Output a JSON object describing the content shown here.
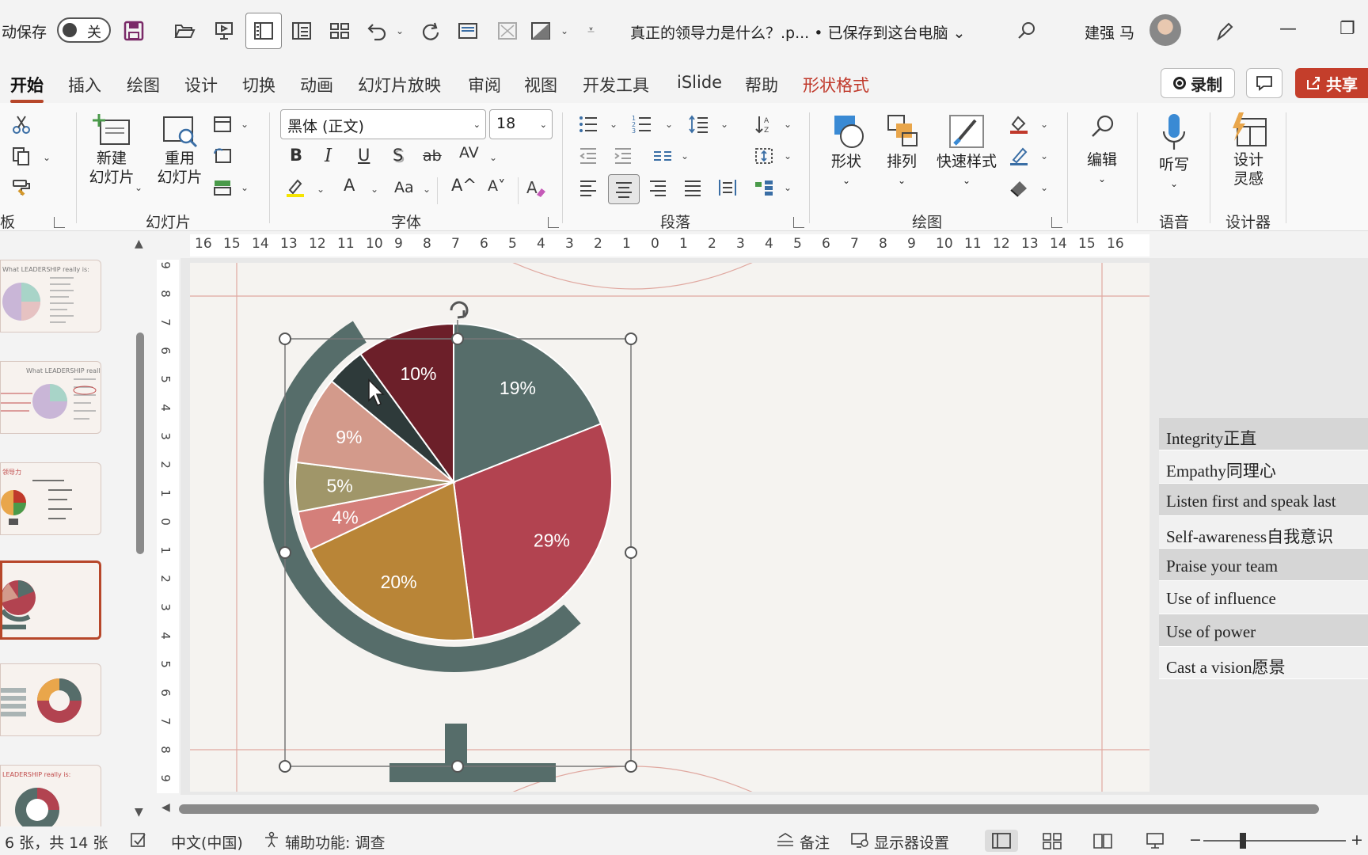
{
  "titlebar": {
    "autosave_label": "动保存",
    "autosave_state": "关",
    "doc_title": "真正的领导力是什么？.p... • 已保存到这台电脑 ⌄",
    "user_name": "建强 马",
    "minimize": "—",
    "restore": "❐"
  },
  "tabs": {
    "items": [
      "开始",
      "插入",
      "绘图",
      "设计",
      "切换",
      "动画",
      "幻灯片放映",
      "审阅",
      "视图",
      "开发工具",
      "iSlide",
      "帮助",
      "形状格式"
    ],
    "record_label": "录制",
    "share_label": "共享"
  },
  "ribbon": {
    "clipboard": {
      "label": "板"
    },
    "slides": {
      "new_slide": [
        "新建",
        "幻灯片"
      ],
      "reuse_slide": [
        "重用",
        "幻灯片"
      ],
      "label": "幻灯片"
    },
    "font": {
      "font_name": "黑体 (正文)",
      "font_size": "18",
      "label": "字体",
      "bold": "B",
      "italic": "I",
      "underline": "U",
      "shadow": "S",
      "strike": "ab",
      "spacing": "AV",
      "color_a": "A",
      "case": "Aa",
      "grow": "A^",
      "shrink": "A˅"
    },
    "paragraph": {
      "label": "段落"
    },
    "drawing": {
      "shapes": "形状",
      "arrange": "排列",
      "quick_styles": "快速样式",
      "label": "绘图"
    },
    "editing": {
      "edit": "编辑"
    },
    "voice": {
      "dictate": "听写",
      "label": "语音"
    },
    "designer": {
      "design_ideas": [
        "设计",
        "灵感"
      ],
      "label": "设计器"
    }
  },
  "chart_data": {
    "type": "pie",
    "slice_labels": [
      "19%",
      "29%",
      "20%",
      "4%",
      "5%",
      "9%",
      "",
      "10%"
    ],
    "values": [
      19,
      29,
      20,
      4,
      5,
      9,
      4,
      10
    ],
    "colors": [
      "#566d6a",
      "#b24350",
      "#b98537",
      "#d47f7a",
      "#a09669",
      "#d39a8b",
      "#2e3a3a",
      "#6c1f29"
    ],
    "legend": [
      "Integrity正直",
      "Empathy同理心",
      "Listen first and speak last",
      "Self-awareness自我意识",
      "Praise your team",
      "Use of influence",
      "Use of power",
      "Cast a vision愿景"
    ]
  },
  "ruler": {
    "horizontal": [
      "16",
      "15",
      "14",
      "13",
      "12",
      "11",
      "10",
      "9",
      "8",
      "7",
      "6",
      "5",
      "4",
      "3",
      "2",
      "1",
      "0",
      "1",
      "2",
      "3",
      "4",
      "5",
      "6",
      "7",
      "8",
      "9",
      "10",
      "11",
      "12",
      "13",
      "14",
      "15",
      "16"
    ],
    "vertical": [
      "9",
      "8",
      "7",
      "6",
      "5",
      "4",
      "3",
      "2",
      "1",
      "0",
      "1",
      "2",
      "3",
      "4",
      "5",
      "6",
      "7",
      "8",
      "9"
    ]
  },
  "statusbar": {
    "slide_count": "6 张，共 14 张",
    "language": "中文(中国)",
    "accessibility": "辅助功能: 调查",
    "notes": "备注",
    "display_settings": "显示器设置",
    "zoom_minus": "−",
    "zoom_plus": "+"
  },
  "theme": {
    "accent": "#b7472a",
    "globe": "#566d6a"
  }
}
